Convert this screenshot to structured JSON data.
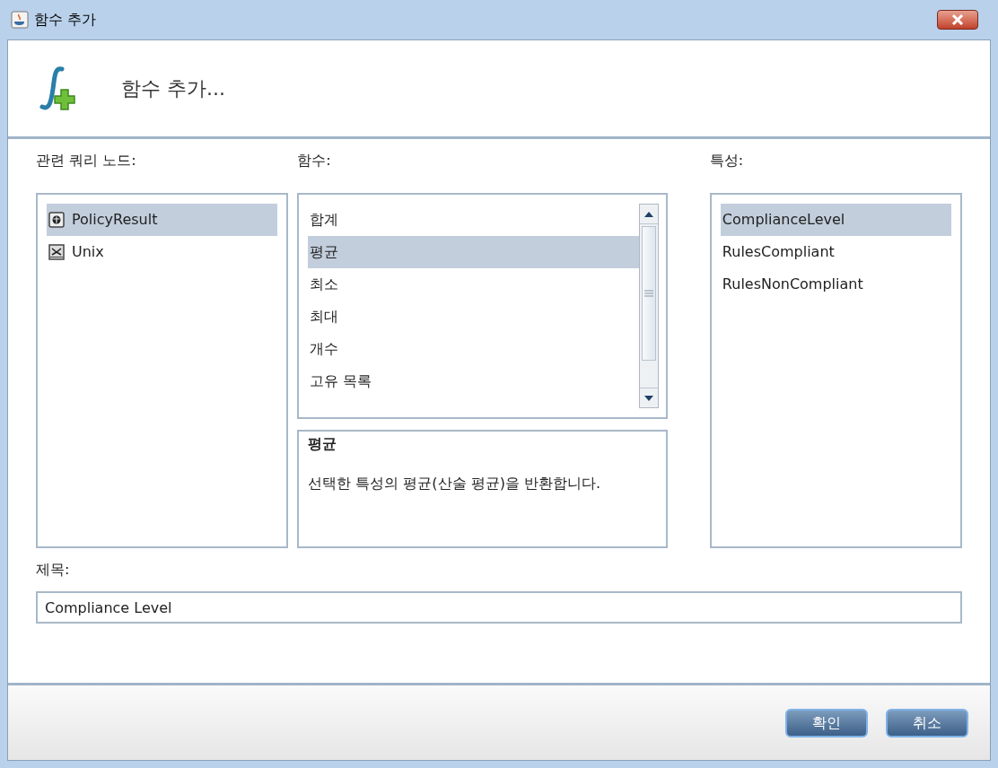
{
  "window": {
    "title": "함수 추가"
  },
  "header": {
    "title": "함수 추가..."
  },
  "nodes": {
    "label": "관련 쿼리 노드:",
    "items": [
      {
        "label": "PolicyResult",
        "kind": "policy",
        "selected": true
      },
      {
        "label": "Unix",
        "kind": "unix",
        "selected": false
      }
    ]
  },
  "functions": {
    "label": "함수:",
    "items": [
      {
        "label": "합계",
        "selected": false
      },
      {
        "label": "평균",
        "selected": true
      },
      {
        "label": "최소",
        "selected": false
      },
      {
        "label": "최대",
        "selected": false
      },
      {
        "label": "개수",
        "selected": false
      },
      {
        "label": "고유 목록",
        "selected": false
      }
    ],
    "description": {
      "title": "평균",
      "text": "선택한 특성의 평균(산술 평균)을 반환합니다."
    }
  },
  "attributes": {
    "label": "특성:",
    "items": [
      {
        "label": "ComplianceLevel",
        "selected": true
      },
      {
        "label": "RulesCompliant",
        "selected": false
      },
      {
        "label": "RulesNonCompliant",
        "selected": false
      }
    ]
  },
  "title_field": {
    "label": "제목:",
    "value": "Compliance Level"
  },
  "buttons": [
    "확인",
    "취소"
  ]
}
